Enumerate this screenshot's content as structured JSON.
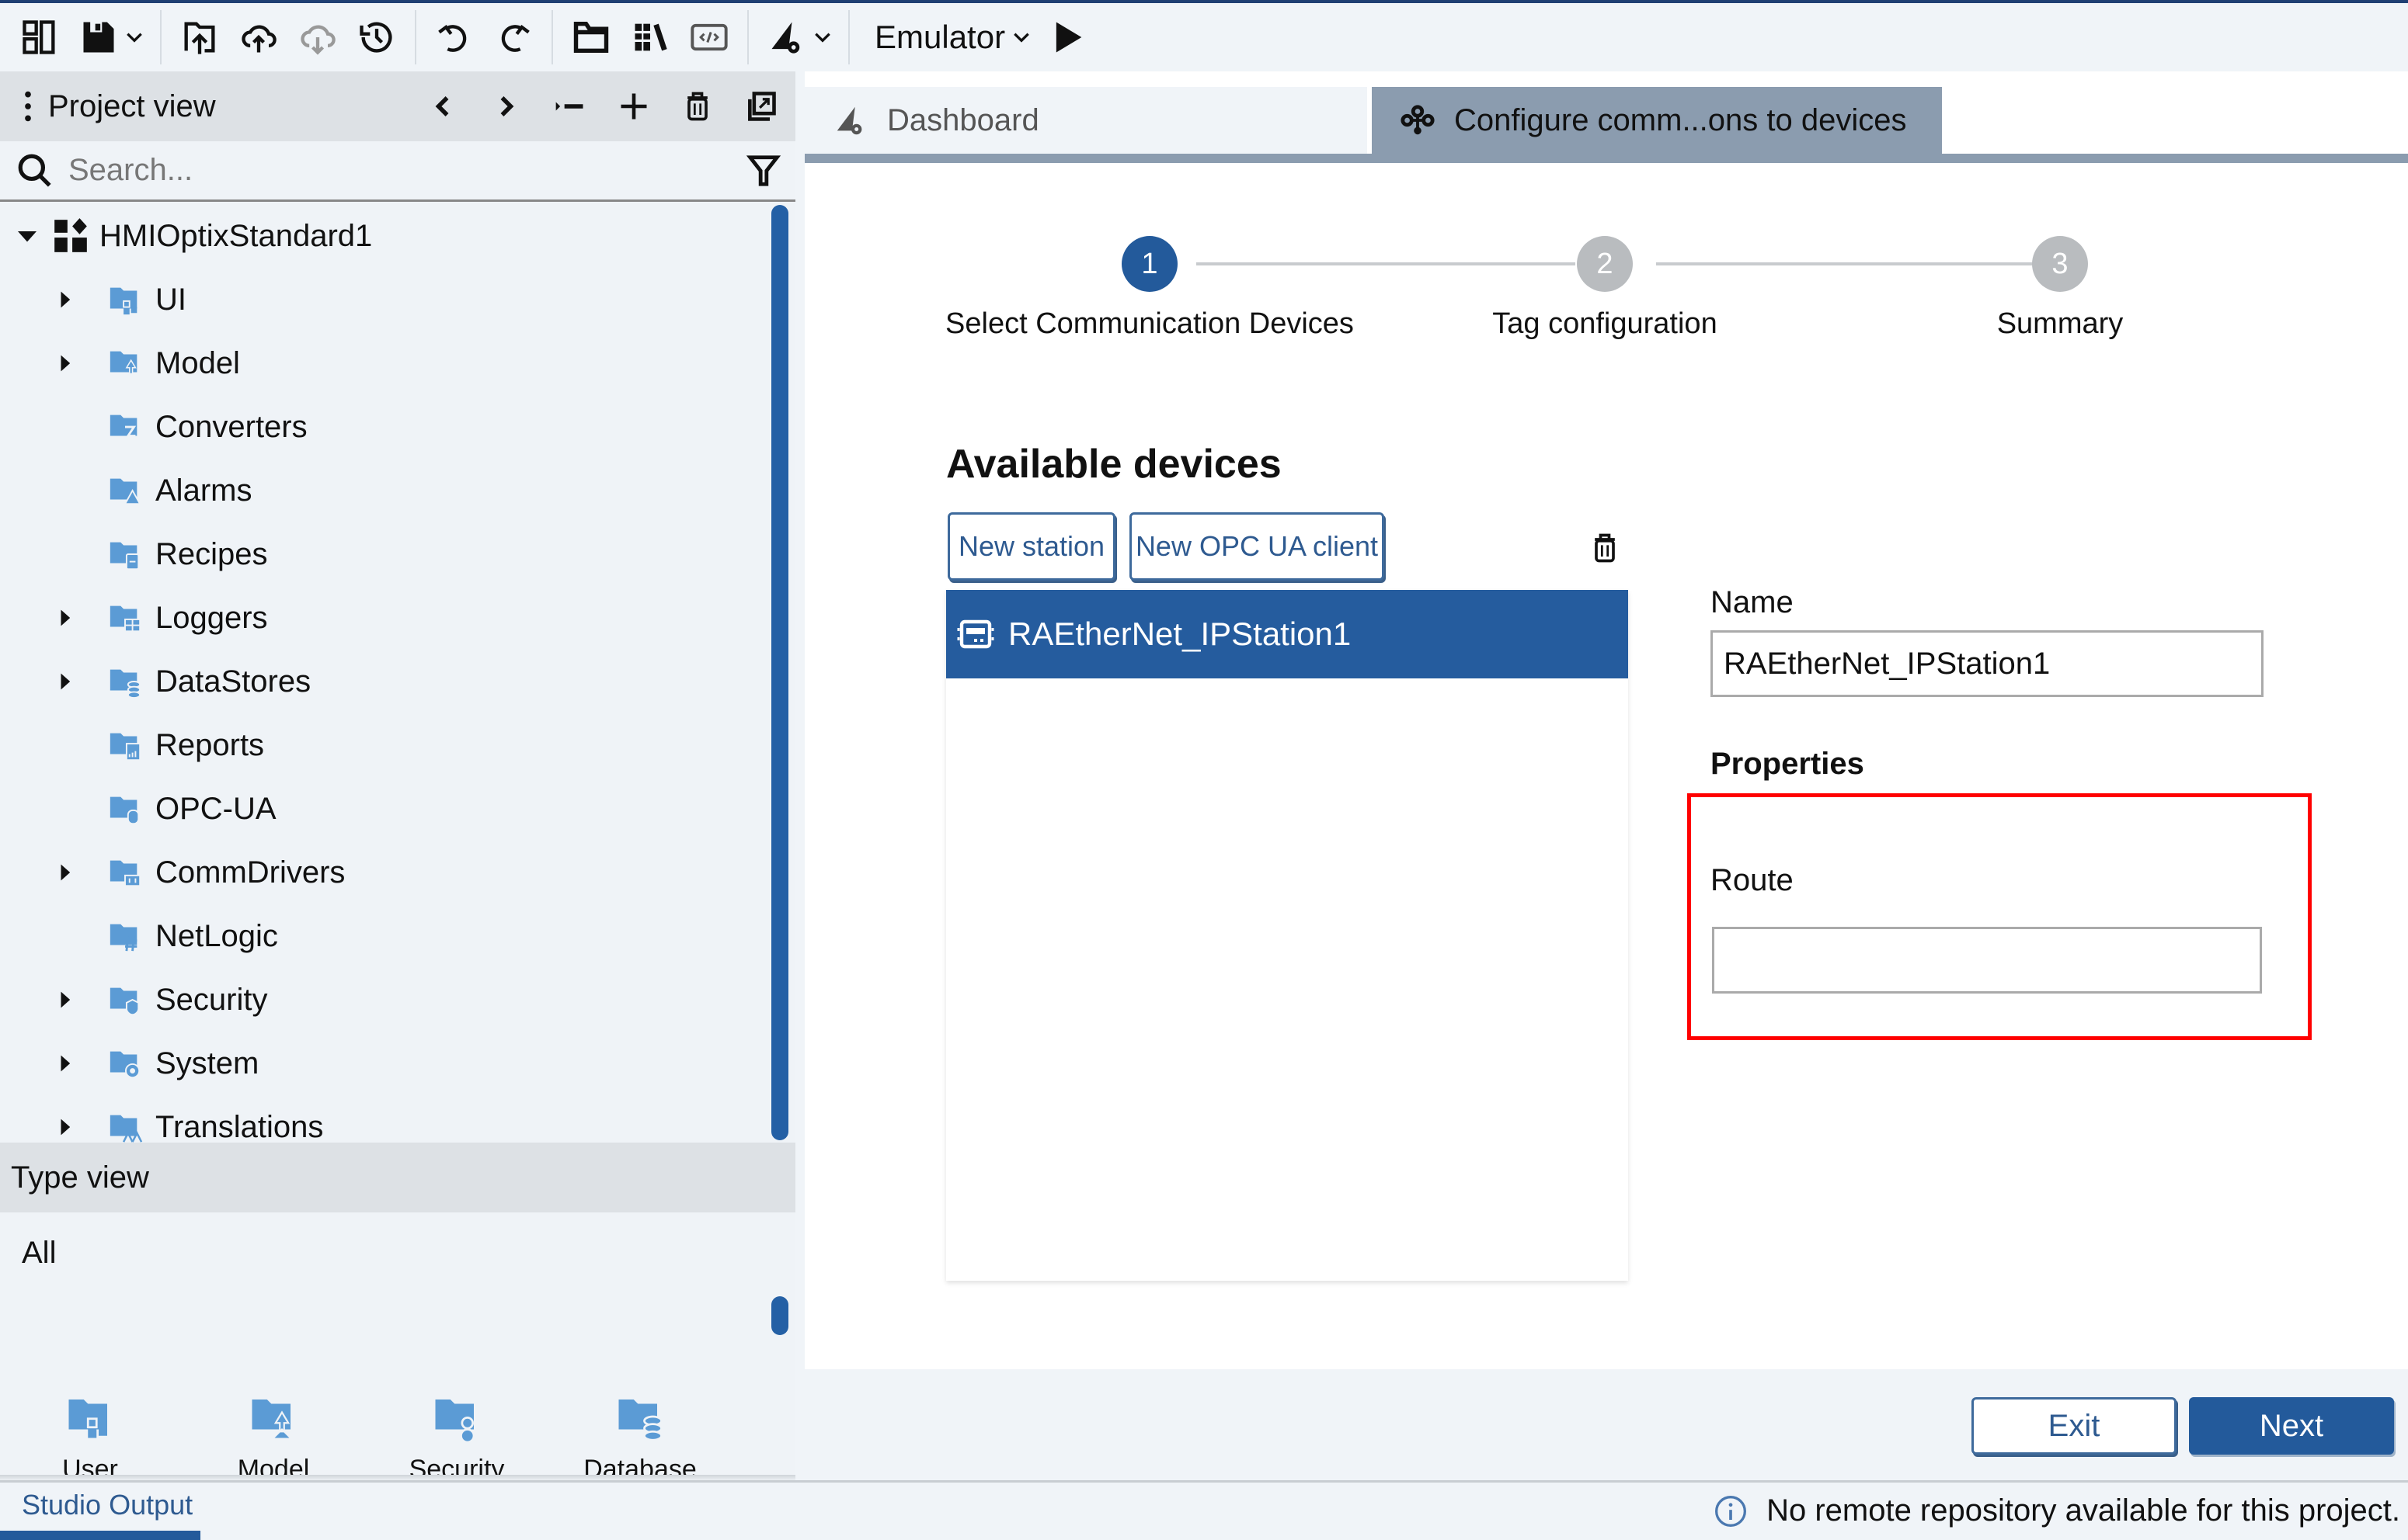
{
  "toolbar": {
    "icons": [
      "layout-icon",
      "save-icon",
      "chevron-down-icon",
      "upload-project-icon",
      "cloud-upload-icon",
      "cloud-download-icon",
      "history-icon",
      "undo-icon",
      "redo-icon",
      "open-folder-icon",
      "library-icon",
      "code-icon",
      "deploy-settings-icon",
      "chevron-down-icon",
      "play-icon"
    ],
    "run_target": "Emulator"
  },
  "project_view": {
    "title": "Project view",
    "search_placeholder": "Search...",
    "tree": {
      "root": "HMIOptixStandard1",
      "items": [
        {
          "label": "UI",
          "expandable": true,
          "icon": "ui-folder-icon"
        },
        {
          "label": "Model",
          "expandable": true,
          "icon": "model-folder-icon"
        },
        {
          "label": "Converters",
          "expandable": false,
          "icon": "converters-folder-icon"
        },
        {
          "label": "Alarms",
          "expandable": false,
          "icon": "alarms-folder-icon"
        },
        {
          "label": "Recipes",
          "expandable": false,
          "icon": "recipes-folder-icon"
        },
        {
          "label": "Loggers",
          "expandable": true,
          "icon": "loggers-folder-icon"
        },
        {
          "label": "DataStores",
          "expandable": true,
          "icon": "datastores-folder-icon"
        },
        {
          "label": "Reports",
          "expandable": false,
          "icon": "reports-folder-icon"
        },
        {
          "label": "OPC-UA",
          "expandable": false,
          "icon": "opcua-folder-icon"
        },
        {
          "label": "CommDrivers",
          "expandable": true,
          "icon": "commdrivers-folder-icon"
        },
        {
          "label": "NetLogic",
          "expandable": false,
          "icon": "netlogic-folder-icon"
        },
        {
          "label": "Security",
          "expandable": true,
          "icon": "security-folder-icon"
        },
        {
          "label": "System",
          "expandable": true,
          "icon": "system-folder-icon"
        },
        {
          "label": "Translations",
          "expandable": true,
          "icon": "translations-folder-icon"
        }
      ]
    }
  },
  "type_view": {
    "title": "Type view",
    "filter": "All",
    "items": [
      {
        "label": "User interface"
      },
      {
        "label": "Model"
      },
      {
        "label": "Security"
      },
      {
        "label": "Database"
      }
    ]
  },
  "tabs": [
    {
      "label": "Dashboard",
      "active": false
    },
    {
      "label": "Configure comm...ons to devices",
      "active": true
    }
  ],
  "wizard": {
    "current_step": 1,
    "steps": [
      {
        "number": "1",
        "label": "Select Communication Devices"
      },
      {
        "number": "2",
        "label": "Tag configuration"
      },
      {
        "number": "3",
        "label": "Summary"
      }
    ],
    "available_devices_title": "Available devices",
    "new_station_label": "New station",
    "new_opcua_client_label": "New OPC UA client",
    "devices": [
      {
        "name": "RAEtherNet_IPStation1",
        "selected": true
      }
    ],
    "name_label": "Name",
    "name_value": "RAEtherNet_IPStation1",
    "properties_label": "Properties",
    "route_label": "Route",
    "route_value": "",
    "exit_label": "Exit",
    "next_label": "Next"
  },
  "status_bar": {
    "output_tab": "Studio Output",
    "message": "No remote repository available for this project."
  },
  "colors": {
    "accent": "#235a9b",
    "active_tab": "#8b9caf",
    "highlight": "#ff0000",
    "step_inactive": "#b9bcbf"
  }
}
